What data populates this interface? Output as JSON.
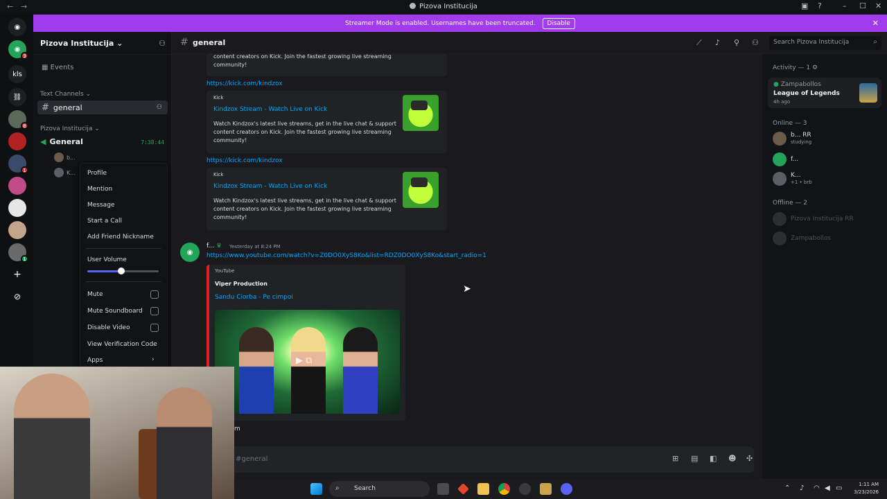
{
  "window": {
    "title": "Pizova Institucija",
    "back_icon": "←",
    "forward_icon": "→",
    "controls": [
      "–",
      "☐",
      "✕"
    ]
  },
  "banner": {
    "text": "Streamer Mode is enabled. Usernames have been truncated.",
    "button": "Disable",
    "close": "✕"
  },
  "rail": {
    "labels": [
      "kls"
    ],
    "badges": [
      "3",
      "8",
      "1",
      "1"
    ]
  },
  "sidebar": {
    "server_name": "Pizova Institucija ⌄",
    "events": "Events",
    "text_channels_header": "Text Channels ⌄",
    "active_channel": "general",
    "voice_category": "Pizova Institucija ⌄",
    "voice_channel": "General",
    "voice_timer": "7:38:44",
    "voice_users": [
      "b...",
      "K..."
    ]
  },
  "context_menu": {
    "items": [
      "Profile",
      "Mention",
      "Message",
      "Start a Call",
      "Add Friend Nickname"
    ],
    "volume_label": "User Volume",
    "volume_level": 0.48,
    "toggles": [
      "Mute",
      "Mute Soundboard",
      "Disable Video"
    ],
    "verification": "View Verification Code",
    "apps": "Apps",
    "apps_arrow": "›"
  },
  "header": {
    "channel": "general",
    "search_placeholder": "Search Pizova Institucija"
  },
  "chat": {
    "partial_embed_desc": "content creators on Kick. Join the fastest growing live streaming community!",
    "kick_link": "https://kick.com/kindzox",
    "kick_embed": {
      "provider": "Kick",
      "title": "Kindzox Stream - Watch Live on Kick",
      "description": "Watch Kindzox's latest live streams, get in the live chat & support content creators on Kick. Join the fastest growing live streaming community!"
    },
    "message": {
      "author": "f...",
      "timestamp": "Yesterday at 8:24 PM",
      "link": "https://www.youtube.com/watch?v=Z0DO0XyS8Ko&list=RDZ0DO0XyS8Ko&start_radio=1"
    },
    "youtube_embed": {
      "provider": "YouTube",
      "author": "Viper Production",
      "title": "Sandu Ciorba - Pe cimpoi"
    },
    "trailing_text": "m",
    "composer_placeholder": "#general"
  },
  "members": {
    "activity_header": "Activity — 1",
    "activity": {
      "name": "Zampabollos",
      "game": "League of Legends",
      "time": "4h ago"
    },
    "online_header": "Online — 3",
    "online": [
      {
        "name": "b... RR",
        "status": "studying"
      },
      {
        "name": "f...",
        "status": ""
      },
      {
        "name": "K...",
        "status": "+1 • brb"
      }
    ],
    "offline_header": "Offline — 2",
    "offline": [
      "Pizova Institucija RR",
      "Zampabollos"
    ]
  },
  "taskbar": {
    "search": "Search",
    "time": "1:11 AM",
    "date": "3/23/2026"
  },
  "colors": {
    "banner": "#a13ced",
    "link": "#00a8fc",
    "online": "#23a559",
    "youtube": "#e11d23"
  }
}
